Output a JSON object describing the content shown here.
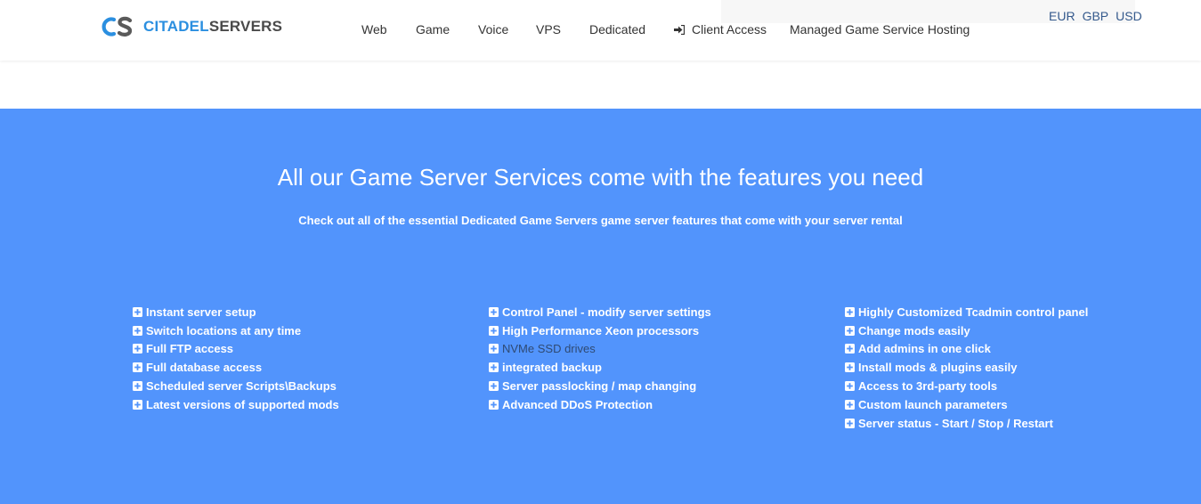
{
  "header": {
    "logo": {
      "brand_part1": "CITADEL",
      "brand_part2": "SERVERS",
      "mark_letters": "CS"
    },
    "nav": [
      {
        "label": "Web"
      },
      {
        "label": "Game"
      },
      {
        "label": "Voice"
      },
      {
        "label": "VPS"
      },
      {
        "label": "Dedicated"
      },
      {
        "label": "Client Access",
        "icon": "sign-in-icon"
      },
      {
        "label": "Managed Game Service Hosting"
      }
    ],
    "currency": [
      "EUR",
      "GBP",
      "USD"
    ]
  },
  "hero": {
    "title": "All our Game Server Services come with the features you need",
    "subtitle": "Check out all of the essential Dedicated Game Servers game server features that come with your server rental"
  },
  "features": {
    "icon": "plus-square-icon",
    "columns": [
      [
        "Instant server setup",
        "Switch locations at any time",
        "Full FTP access",
        "Full database access",
        "Scheduled server Scripts\\Backups",
        "Latest versions of supported mods"
      ],
      [
        "Control Panel - modify server settings",
        "High Performance Xeon processors",
        "NVMe SSD drives",
        "integrated backup",
        "Server passlocking / map changing",
        "Advanced DDoS Protection"
      ],
      [
        "Highly Customized Tcadmin control panel",
        "Change mods easily",
        "Add admins in one click",
        "Install mods & plugins easily",
        "Access to 3rd-party tools",
        "Custom launch parameters",
        "Server status - Start / Stop / Restart"
      ]
    ]
  },
  "colors": {
    "hero_background": "#5294fc",
    "logo_accent": "#2b8fe0",
    "currency_link": "#34598c",
    "muted_feature": "#2f4a73"
  }
}
